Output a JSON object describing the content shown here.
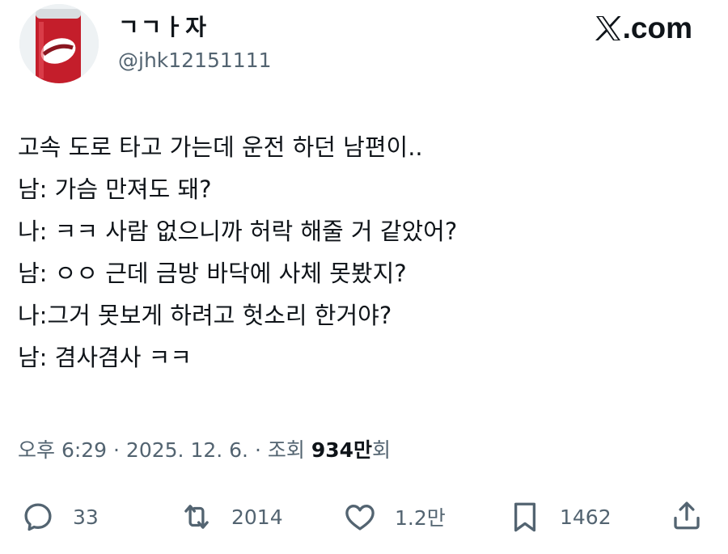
{
  "author": {
    "display_name": "ㄱㄱㅏ자",
    "handle": "@jhk12151111",
    "avatar_icon": "soda-can-avatar"
  },
  "brand": {
    "label": ".com",
    "icon": "x-logo-icon"
  },
  "tweet": {
    "lines": [
      "고속 도로 타고 가는데 운전 하던 남편이..",
      "남: 가슴 만져도 돼?",
      "나: ㅋㅋ 사람 없으니까 허락 해줄 거 같았어?",
      "남: ㅇㅇ 근데 금방 바닥에 사체 못봤지?",
      "나:그거 못보게 하려고 헛소리 한거야?",
      "남: 겸사겸사 ㅋㅋ"
    ]
  },
  "meta": {
    "time_date": "오후 6:29 · 2025. 12. 6. · 조회",
    "views_count": "934만",
    "views_suffix": "회"
  },
  "actions": {
    "reply_count": "33",
    "retweet_count": "2014",
    "like_count": "1.2만",
    "bookmark_count": "1462"
  },
  "colors": {
    "text": "#0f1419",
    "secondary": "#536471",
    "avatar_can": "#c41e2b"
  }
}
